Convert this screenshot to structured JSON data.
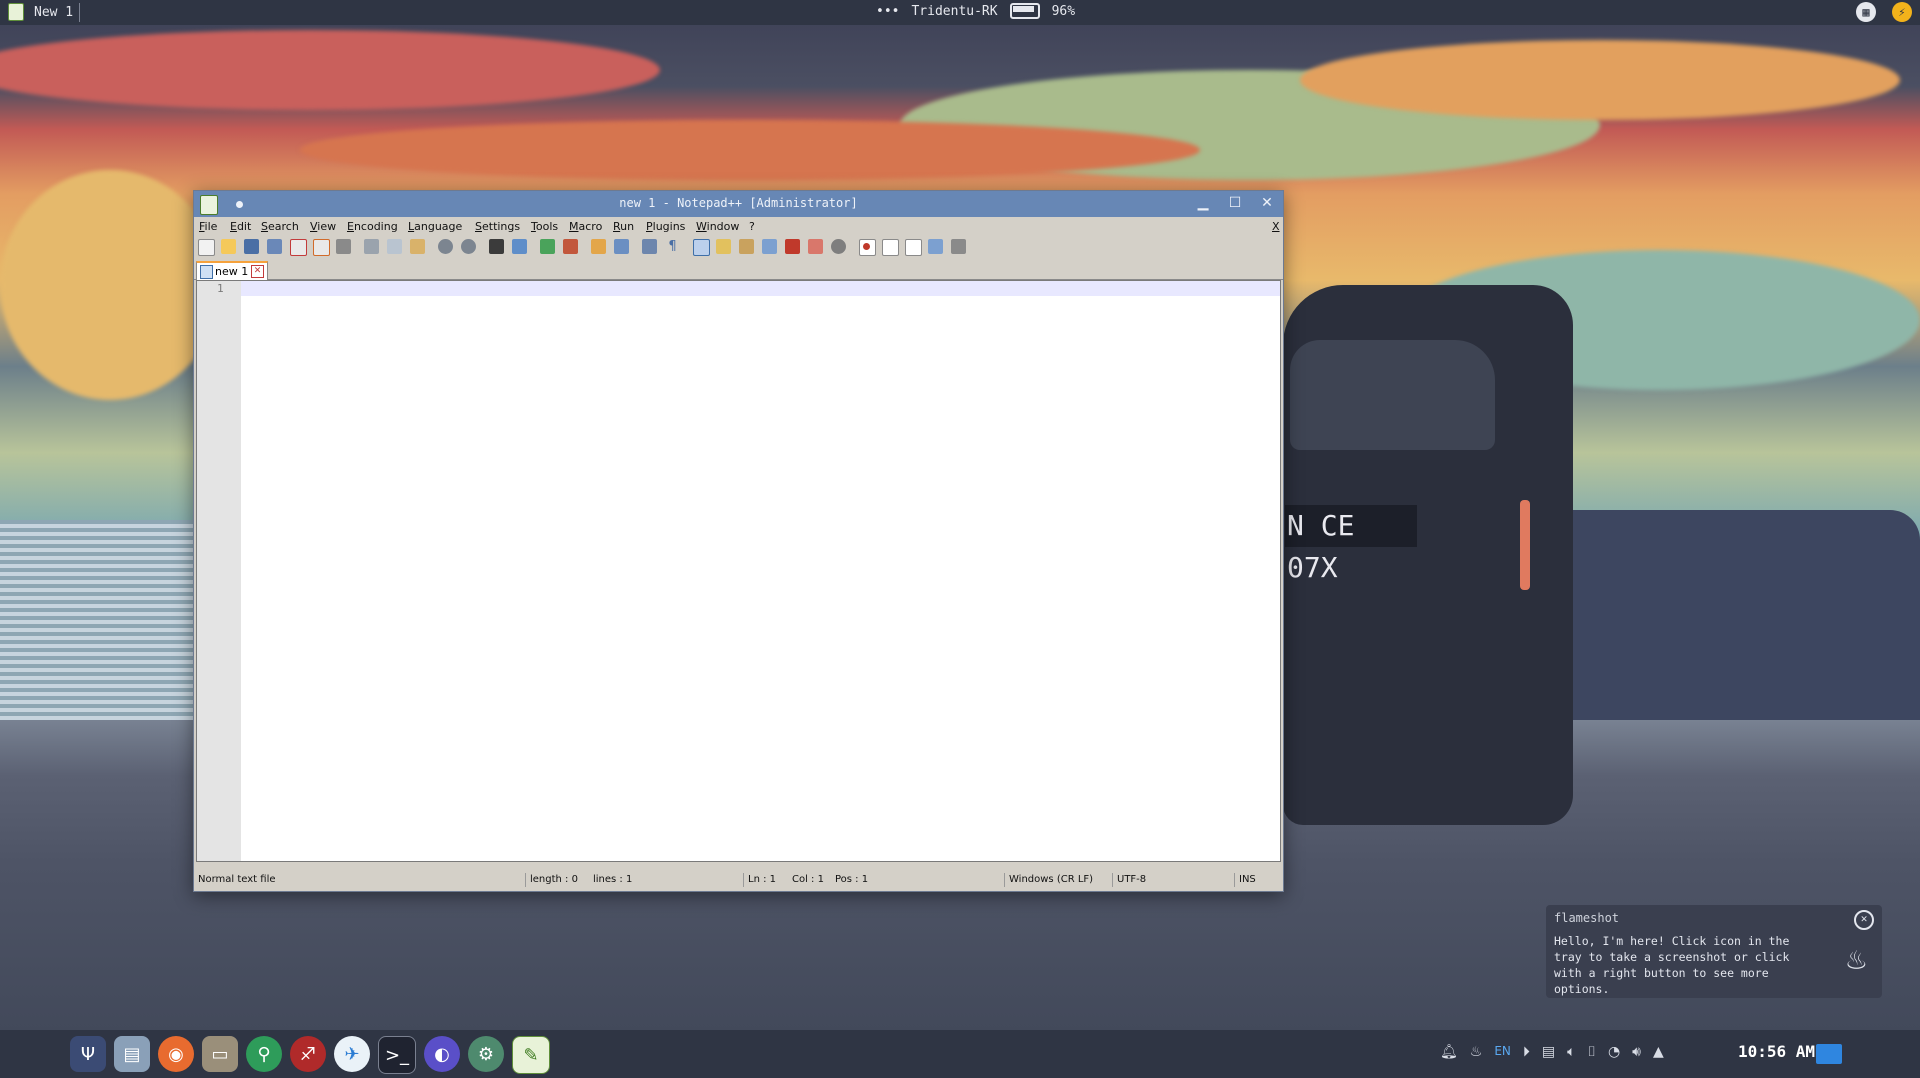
{
  "top_panel": {
    "app_name": "New 1",
    "ellipsis": "•••",
    "host": "Tridentu-RK",
    "battery": "96%"
  },
  "window": {
    "title": "new 1 - Notepad++ [Administrator]",
    "menu": [
      "File",
      "Edit",
      "Search",
      "View",
      "Encoding",
      "Language",
      "Settings",
      "Tools",
      "Macro",
      "Run",
      "Plugins",
      "Window",
      "?"
    ],
    "menu_close": "X",
    "tab_label": "new 1",
    "line_number": "1",
    "status": {
      "type": "Normal text file",
      "length": "length : 0",
      "lines": "lines : 1",
      "ln": "Ln : 1",
      "col": "Col : 1",
      "pos": "Pos : 1",
      "eol": "Windows (CR LF)",
      "encoding": "UTF-8",
      "mode": "INS"
    }
  },
  "notification": {
    "title": "flameshot",
    "body": "Hello, I'm here! Click icon in the tray to take a screenshot or click with a right button to see more options."
  },
  "taskbar": {
    "tray_lang": "EN",
    "clock": "10:56 AM"
  },
  "wallpaper": {
    "plate": "N CE 07X"
  }
}
